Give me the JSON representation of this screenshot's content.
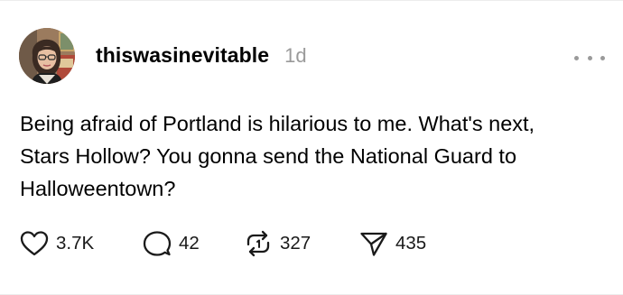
{
  "post": {
    "username": "thiswasinevitable",
    "timestamp": "1d",
    "text": "Being afraid of Portland is hilarious to me. What's next, Stars Hollow? You gonna send the National Guard to Halloweentown?",
    "actions": {
      "like_count": "3.7K",
      "reply_count": "42",
      "repost_count": "327",
      "share_count": "435"
    }
  },
  "icons": {
    "more": "more-horizontal-icon",
    "like": "heart-icon",
    "reply": "speech-bubble-icon",
    "repost": "repost-arrows-icon",
    "share": "paper-plane-icon"
  },
  "colors": {
    "text": "#000000",
    "muted": "#9a9a9a",
    "background": "#ffffff"
  }
}
